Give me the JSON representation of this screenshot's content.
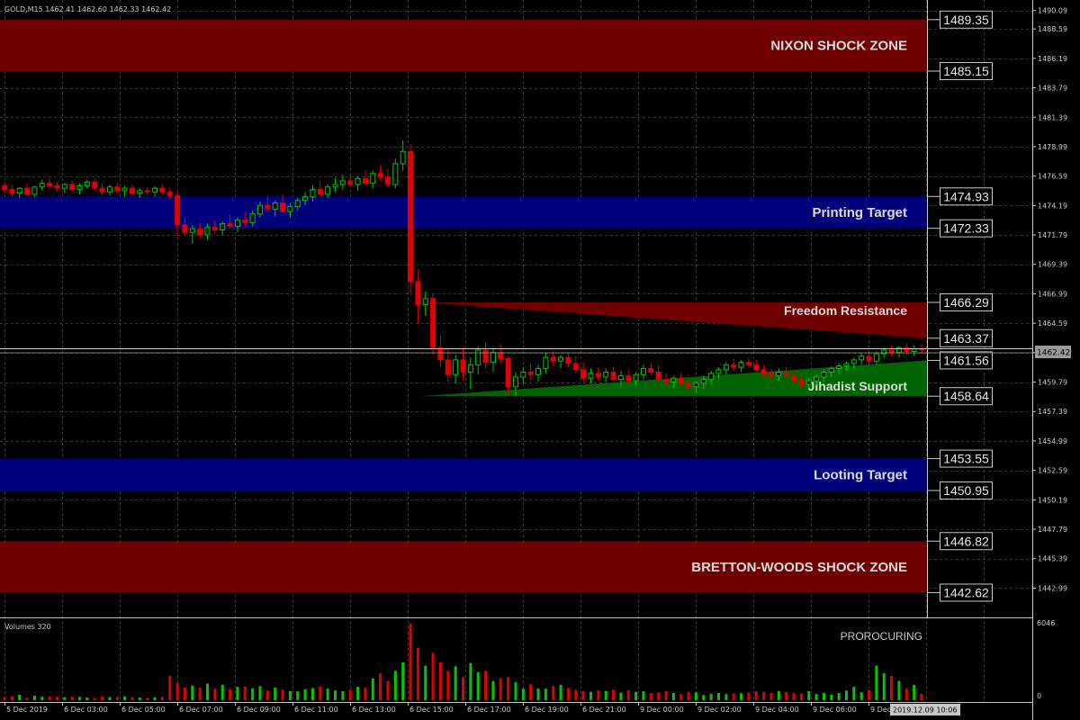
{
  "header": {
    "symbol_info": "GOLD,M15  1462.41 1462.60 1462.33 1462.42"
  },
  "volume_panel": {
    "label": "Volumes 320",
    "brand": "PROROCURING",
    "axis_max": "6046",
    "axis_min": "0"
  },
  "current_price_label": "1462.42",
  "cursor_time": "2019.12.09 10:06",
  "colors": {
    "background": "#000000",
    "grid": "#2e3a2e",
    "bull": "#00c800",
    "bear": "#e00000",
    "shock_zone": "#6e0000",
    "target_zone": "#00007a",
    "support_fill": "#006400",
    "resistance_fill": "#6e0000"
  },
  "chart_data": {
    "type": "candlestick",
    "y_range": [
      1440.6,
      1490.95
    ],
    "price_ticks": [
      "1490.09",
      "1488.59",
      "1486.19",
      "1483.79",
      "1481.39",
      "1478.99",
      "1476.59",
      "1474.19",
      "1471.79",
      "1469.39",
      "1466.99",
      "1464.59",
      "1462.19",
      "1459.79",
      "1457.39",
      "1454.99",
      "1452.59",
      "1450.19",
      "1447.79",
      "1445.39",
      "1442.99"
    ],
    "time_labels": [
      "5 Dec 2019",
      "6 Dec 03:00",
      "6 Dec 05:00",
      "6 Dec 07:00",
      "6 Dec 09:00",
      "6 Dec 11:00",
      "6 Dec 13:00",
      "6 Dec 15:00",
      "6 Dec 17:00",
      "6 Dec 19:00",
      "6 Dec 21:00",
      "9 Dec 00:00",
      "9 Dec 02:00",
      "9 Dec 04:00",
      "9 Dec 06:00",
      "9 Dec"
    ],
    "levels": [
      {
        "value": 1489.35,
        "label": "1489.35"
      },
      {
        "value": 1485.15,
        "label": "1485.15"
      },
      {
        "value": 1474.93,
        "label": "1474.93"
      },
      {
        "value": 1472.33,
        "label": "1472.33"
      },
      {
        "value": 1466.29,
        "label": "1466.29"
      },
      {
        "value": 1463.37,
        "label": "1463.37"
      },
      {
        "value": 1461.56,
        "label": "1461.56"
      },
      {
        "value": 1458.64,
        "label": "1458.64"
      },
      {
        "value": 1453.55,
        "label": "1453.55"
      },
      {
        "value": 1450.95,
        "label": "1450.95"
      },
      {
        "value": 1446.82,
        "label": "1446.82"
      },
      {
        "value": 1442.62,
        "label": "1442.62"
      }
    ],
    "zones": [
      {
        "name": "NIXON SHOCK ZONE",
        "from": 1485.15,
        "to": 1489.35,
        "kind": "shock"
      },
      {
        "name": "Printing Target",
        "from": 1472.33,
        "to": 1474.93,
        "kind": "target"
      },
      {
        "name": "Looting Target",
        "from": 1450.95,
        "to": 1453.55,
        "kind": "target"
      },
      {
        "name": "BRETTON-WOODS SHOCK ZONE",
        "from": 1442.62,
        "to": 1446.82,
        "kind": "shock"
      }
    ],
    "wedges": [
      {
        "name": "Freedom Resistance",
        "kind": "resistance",
        "upper": 1466.29,
        "lower": 1463.37,
        "start_value": 1466.29
      },
      {
        "name": "Jihadist Support",
        "kind": "support",
        "upper": 1461.56,
        "lower": 1458.64,
        "start_value": 1458.64
      }
    ],
    "candles": [
      [
        1475.8,
        1476.1,
        1475.2,
        1475.5
      ],
      [
        1475.5,
        1475.9,
        1474.9,
        1475.2
      ],
      [
        1475.2,
        1475.7,
        1474.8,
        1475.6
      ],
      [
        1475.6,
        1476.0,
        1475.0,
        1475.1
      ],
      [
        1475.1,
        1475.8,
        1474.9,
        1475.7
      ],
      [
        1475.7,
        1476.3,
        1475.4,
        1476.0
      ],
      [
        1476.0,
        1476.4,
        1475.5,
        1475.8
      ],
      [
        1475.8,
        1476.1,
        1475.3,
        1475.6
      ],
      [
        1475.6,
        1476.0,
        1475.2,
        1475.9
      ],
      [
        1475.9,
        1476.2,
        1475.4,
        1475.5
      ],
      [
        1475.5,
        1476.0,
        1475.1,
        1475.8
      ],
      [
        1475.8,
        1476.3,
        1475.6,
        1476.1
      ],
      [
        1476.1,
        1476.4,
        1475.4,
        1475.6
      ],
      [
        1475.6,
        1476.0,
        1475.0,
        1475.3
      ],
      [
        1475.3,
        1475.9,
        1475.0,
        1475.7
      ],
      [
        1475.7,
        1476.0,
        1475.2,
        1475.4
      ],
      [
        1475.4,
        1475.8,
        1474.9,
        1475.6
      ],
      [
        1475.6,
        1475.9,
        1475.0,
        1475.2
      ],
      [
        1475.2,
        1475.6,
        1474.8,
        1475.4
      ],
      [
        1475.4,
        1475.7,
        1475.0,
        1475.3
      ],
      [
        1475.3,
        1475.8,
        1474.9,
        1475.6
      ],
      [
        1475.6,
        1475.9,
        1475.1,
        1475.3
      ],
      [
        1475.3,
        1475.6,
        1474.7,
        1475.0
      ],
      [
        1475.0,
        1475.4,
        1471.6,
        1472.6
      ],
      [
        1472.6,
        1473.2,
        1471.8,
        1472.0
      ],
      [
        1472.0,
        1472.6,
        1471.1,
        1472.3
      ],
      [
        1472.3,
        1472.8,
        1471.5,
        1471.8
      ],
      [
        1471.8,
        1472.7,
        1471.4,
        1472.4
      ],
      [
        1472.4,
        1473.0,
        1471.9,
        1472.2
      ],
      [
        1472.2,
        1472.9,
        1471.8,
        1472.7
      ],
      [
        1472.7,
        1473.4,
        1472.3,
        1472.5
      ],
      [
        1472.5,
        1473.2,
        1472.0,
        1473.0
      ],
      [
        1473.0,
        1473.6,
        1472.4,
        1472.8
      ],
      [
        1472.8,
        1473.8,
        1472.5,
        1473.5
      ],
      [
        1473.5,
        1474.5,
        1473.2,
        1474.2
      ],
      [
        1474.2,
        1474.9,
        1473.7,
        1473.9
      ],
      [
        1473.9,
        1474.6,
        1473.3,
        1474.4
      ],
      [
        1474.4,
        1475.1,
        1473.9,
        1473.7
      ],
      [
        1473.7,
        1474.4,
        1473.2,
        1474.1
      ],
      [
        1474.1,
        1474.8,
        1473.8,
        1474.6
      ],
      [
        1474.6,
        1475.3,
        1474.2,
        1474.9
      ],
      [
        1474.9,
        1475.8,
        1474.5,
        1475.5
      ],
      [
        1475.5,
        1476.2,
        1474.9,
        1475.1
      ],
      [
        1475.1,
        1475.9,
        1474.8,
        1475.7
      ],
      [
        1475.7,
        1476.4,
        1475.3,
        1475.9
      ],
      [
        1475.9,
        1476.7,
        1475.5,
        1476.2
      ],
      [
        1476.2,
        1476.8,
        1475.7,
        1475.9
      ],
      [
        1475.9,
        1476.6,
        1475.4,
        1476.4
      ],
      [
        1476.4,
        1477.1,
        1475.8,
        1476.0
      ],
      [
        1476.0,
        1477.0,
        1475.6,
        1476.8
      ],
      [
        1476.8,
        1477.5,
        1476.2,
        1476.5
      ],
      [
        1476.5,
        1477.2,
        1475.7,
        1475.9
      ],
      [
        1475.9,
        1478.0,
        1475.6,
        1477.6
      ],
      [
        1477.6,
        1479.5,
        1477.0,
        1478.6
      ],
      [
        1478.6,
        1479.2,
        1467.0,
        1468.0
      ],
      [
        1468.0,
        1469.0,
        1464.6,
        1466.1
      ],
      [
        1466.1,
        1467.2,
        1465.2,
        1466.6
      ],
      [
        1466.6,
        1467.0,
        1462.0,
        1462.6
      ],
      [
        1462.6,
        1463.6,
        1461.0,
        1461.6
      ],
      [
        1461.6,
        1462.6,
        1459.8,
        1460.4
      ],
      [
        1460.4,
        1462.0,
        1459.7,
        1461.6
      ],
      [
        1461.6,
        1462.5,
        1460.0,
        1460.6
      ],
      [
        1460.6,
        1461.8,
        1459.2,
        1461.2
      ],
      [
        1461.2,
        1462.7,
        1460.4,
        1462.4
      ],
      [
        1462.4,
        1463.1,
        1460.9,
        1461.4
      ],
      [
        1461.4,
        1462.6,
        1460.6,
        1462.2
      ],
      [
        1462.2,
        1462.9,
        1461.3,
        1461.7
      ],
      [
        1461.7,
        1461.9,
        1458.8,
        1459.4
      ],
      [
        1459.4,
        1460.6,
        1458.7,
        1460.2
      ],
      [
        1460.2,
        1461.0,
        1459.6,
        1460.6
      ],
      [
        1460.6,
        1461.3,
        1459.9,
        1460.4
      ],
      [
        1460.4,
        1461.2,
        1459.8,
        1460.9
      ],
      [
        1460.9,
        1462.2,
        1460.5,
        1461.8
      ],
      [
        1461.8,
        1462.3,
        1461.1,
        1461.5
      ],
      [
        1461.5,
        1462.0,
        1460.9,
        1461.8
      ],
      [
        1461.8,
        1462.2,
        1461.0,
        1461.3
      ],
      [
        1461.3,
        1461.9,
        1460.5,
        1460.8
      ],
      [
        1460.8,
        1461.4,
        1459.8,
        1460.1
      ],
      [
        1460.1,
        1460.9,
        1459.7,
        1460.5
      ],
      [
        1460.5,
        1461.0,
        1459.9,
        1460.2
      ],
      [
        1460.2,
        1460.9,
        1459.8,
        1460.6
      ],
      [
        1460.6,
        1461.0,
        1459.9,
        1460.0
      ],
      [
        1460.0,
        1460.7,
        1459.4,
        1460.3
      ],
      [
        1460.3,
        1460.8,
        1459.7,
        1459.9
      ],
      [
        1459.9,
        1460.6,
        1459.5,
        1460.4
      ],
      [
        1460.4,
        1461.2,
        1460.0,
        1460.9
      ],
      [
        1460.9,
        1461.4,
        1460.3,
        1460.6
      ],
      [
        1460.6,
        1461.2,
        1459.8,
        1460.0
      ],
      [
        1460.0,
        1460.5,
        1459.5,
        1459.8
      ],
      [
        1459.8,
        1460.3,
        1459.3,
        1460.1
      ],
      [
        1460.1,
        1460.6,
        1459.5,
        1459.7
      ],
      [
        1459.7,
        1460.1,
        1459.1,
        1459.4
      ],
      [
        1459.4,
        1459.9,
        1458.9,
        1459.7
      ],
      [
        1459.7,
        1460.3,
        1459.2,
        1460.0
      ],
      [
        1460.0,
        1460.7,
        1459.6,
        1460.5
      ],
      [
        1460.5,
        1461.0,
        1460.1,
        1460.8
      ],
      [
        1460.8,
        1461.4,
        1460.4,
        1461.2
      ],
      [
        1461.2,
        1461.7,
        1460.7,
        1461.0
      ],
      [
        1461.0,
        1461.6,
        1460.6,
        1461.4
      ],
      [
        1461.4,
        1461.8,
        1460.9,
        1461.2
      ],
      [
        1461.2,
        1461.6,
        1460.6,
        1460.8
      ],
      [
        1460.8,
        1461.2,
        1460.2,
        1460.5
      ],
      [
        1460.5,
        1460.9,
        1460.0,
        1460.3
      ],
      [
        1460.3,
        1460.9,
        1459.9,
        1460.6
      ],
      [
        1460.6,
        1461.0,
        1460.1,
        1460.3
      ],
      [
        1460.3,
        1460.7,
        1459.7,
        1459.9
      ],
      [
        1459.9,
        1460.3,
        1459.3,
        1459.6
      ],
      [
        1459.6,
        1460.1,
        1459.2,
        1459.9
      ],
      [
        1459.9,
        1460.4,
        1459.5,
        1460.2
      ],
      [
        1460.2,
        1460.8,
        1459.8,
        1460.6
      ],
      [
        1460.6,
        1461.1,
        1460.2,
        1460.9
      ],
      [
        1460.9,
        1461.3,
        1460.4,
        1461.1
      ],
      [
        1461.1,
        1461.5,
        1460.7,
        1461.3
      ],
      [
        1461.3,
        1461.8,
        1460.9,
        1461.6
      ],
      [
        1461.6,
        1462.2,
        1461.2,
        1461.9
      ],
      [
        1461.9,
        1462.3,
        1461.2,
        1461.5
      ],
      [
        1461.5,
        1462.3,
        1461.2,
        1462.1
      ],
      [
        1462.1,
        1462.6,
        1461.7,
        1462.4
      ],
      [
        1462.4,
        1462.8,
        1461.9,
        1462.2
      ],
      [
        1462.2,
        1462.7,
        1461.8,
        1462.6
      ],
      [
        1462.6,
        1463.0,
        1462.0,
        1462.3
      ],
      [
        1462.3,
        1462.8,
        1461.9,
        1462.5
      ],
      [
        1462.5,
        1462.9,
        1462.1,
        1462.4
      ]
    ],
    "volumes": [
      260,
      310,
      420,
      190,
      350,
      280,
      300,
      260,
      220,
      310,
      250,
      200,
      180,
      290,
      240,
      260,
      300,
      220,
      210,
      180,
      230,
      260,
      1900,
      1350,
      980,
      1150,
      980,
      1300,
      900,
      1200,
      860,
      1050,
      1080,
      920,
      1100,
      760,
      980,
      820,
      720,
      690,
      850,
      940,
      1080,
      900,
      760,
      700,
      820,
      1050,
      960,
      1700,
      2100,
      1500,
      2300,
      2950,
      5980,
      4100,
      2700,
      3700,
      2950,
      2300,
      2650,
      1800,
      2900,
      2200,
      2300,
      1500,
      1700,
      1800,
      1400,
      900,
      1250,
      900,
      900,
      1100,
      1200,
      950,
      800,
      700,
      650,
      760,
      720,
      820,
      590,
      780,
      650,
      700,
      540,
      600,
      700,
      560,
      480,
      650,
      620,
      400,
      500,
      560,
      480,
      520,
      540,
      600,
      700,
      650,
      560,
      720,
      640,
      580,
      520,
      700,
      480,
      560,
      440,
      560,
      760,
      1050,
      620,
      800,
      2700,
      2100,
      1900,
      1500,
      900,
      1200,
      500
    ]
  }
}
